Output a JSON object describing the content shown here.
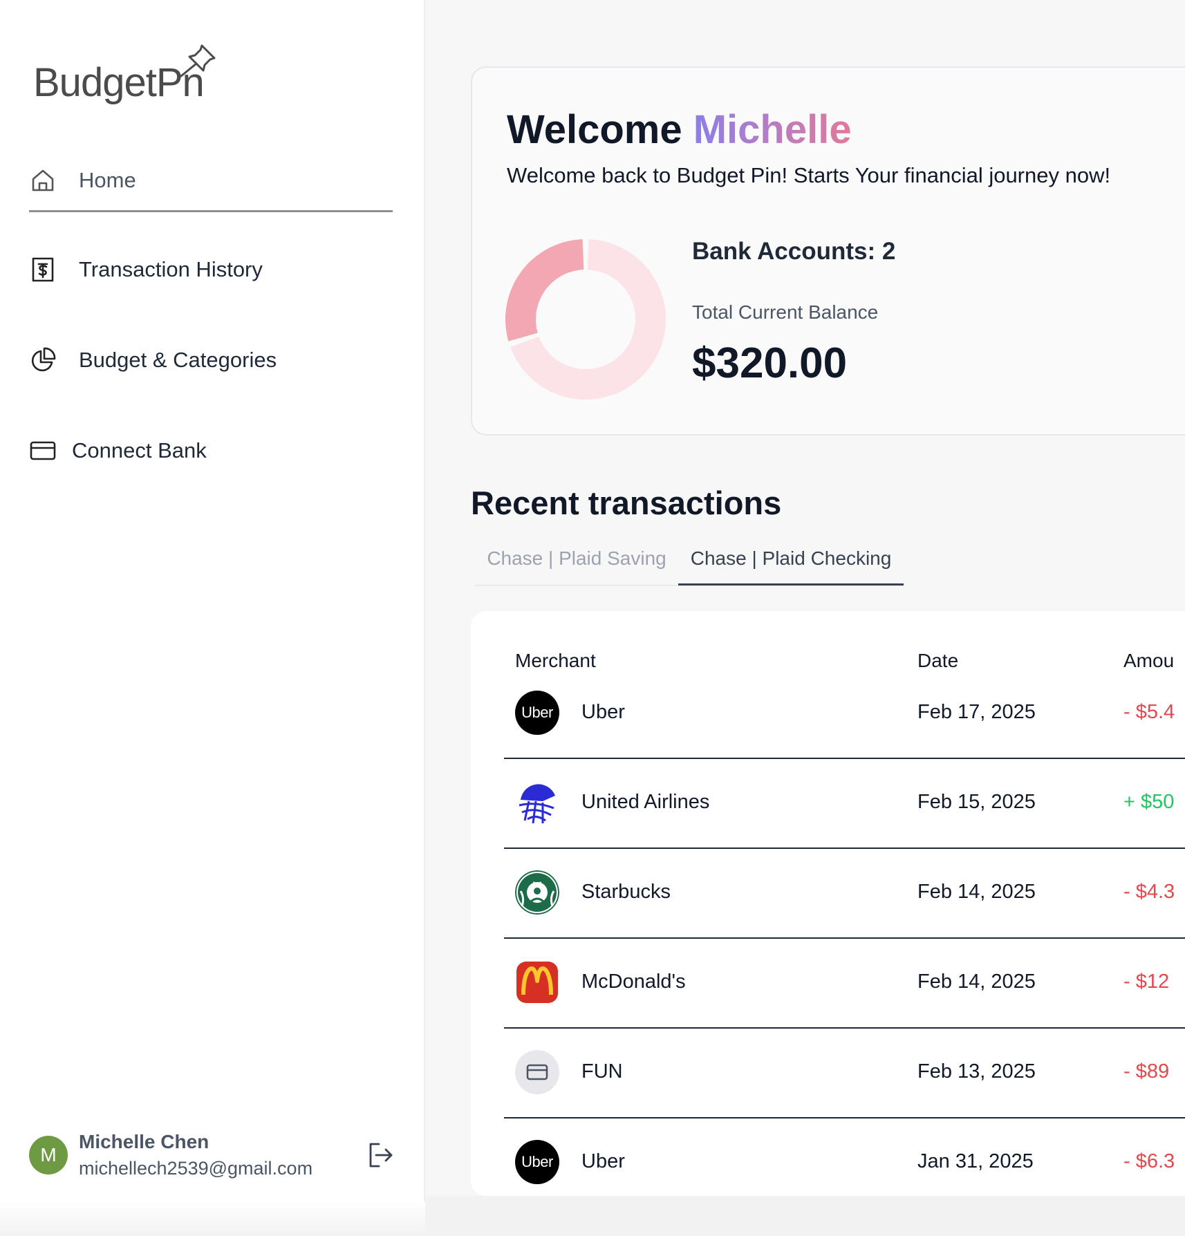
{
  "sidebar": {
    "logo_text": "BudgetPin",
    "logo_visible_text": "BudgetP",
    "logo_trailing": "n",
    "nav": [
      {
        "label": "Home",
        "icon": "home-icon",
        "active": true
      },
      {
        "label": "Transaction History",
        "icon": "receipt-dollar-icon",
        "active": false
      },
      {
        "label": "Budget & Categories",
        "icon": "pie-chart-icon",
        "active": false
      },
      {
        "label": "Connect Bank",
        "icon": "credit-card-icon",
        "active": false
      }
    ],
    "user": {
      "initial": "M",
      "name": "Michelle Chen",
      "email": "michellech2539@gmail.com",
      "avatar_color": "#6f9a44"
    }
  },
  "welcome": {
    "prefix": "Welcome",
    "name": "Michelle",
    "subtitle": "Welcome back to Budget Pin! Starts Your financial journey now!",
    "bank_accounts": "Bank Accounts: 2",
    "balance_label": "Total Current Balance",
    "balance_value": "$320.00",
    "donut": {
      "segments": [
        {
          "fraction": 0.7,
          "color": "#fbe3e7"
        },
        {
          "fraction": 0.3,
          "color": "#f2a7b3"
        }
      ]
    }
  },
  "recent": {
    "title": "Recent transactions",
    "tabs": [
      {
        "label": "Chase | Plaid Saving",
        "active": false
      },
      {
        "label": "Chase | Plaid Checking",
        "active": true
      }
    ],
    "columns": {
      "merchant": "Merchant",
      "date": "Date",
      "amount": "Amou"
    },
    "rows": [
      {
        "merchant": "Uber",
        "date": "Feb 17, 2025",
        "amount": "- $5.4",
        "sign": "neg",
        "logo": "uber"
      },
      {
        "merchant": "United Airlines",
        "date": "Feb 15, 2025",
        "amount": "+ $50",
        "sign": "pos",
        "logo": "united"
      },
      {
        "merchant": "Starbucks",
        "date": "Feb 14, 2025",
        "amount": "- $4.3",
        "sign": "neg",
        "logo": "starbucks"
      },
      {
        "merchant": "McDonald's",
        "date": "Feb 14, 2025",
        "amount": "- $12",
        "sign": "neg",
        "logo": "mcdonalds"
      },
      {
        "merchant": "FUN",
        "date": "Feb 13, 2025",
        "amount": "- $89",
        "sign": "neg",
        "logo": "card"
      },
      {
        "merchant": "Uber",
        "date": "Jan 31, 2025",
        "amount": "- $6.3",
        "sign": "neg",
        "logo": "uber"
      }
    ],
    "uber_logo_text": "Uber",
    "colors": {
      "negative": "#e5484d",
      "positive": "#22c55e"
    }
  }
}
